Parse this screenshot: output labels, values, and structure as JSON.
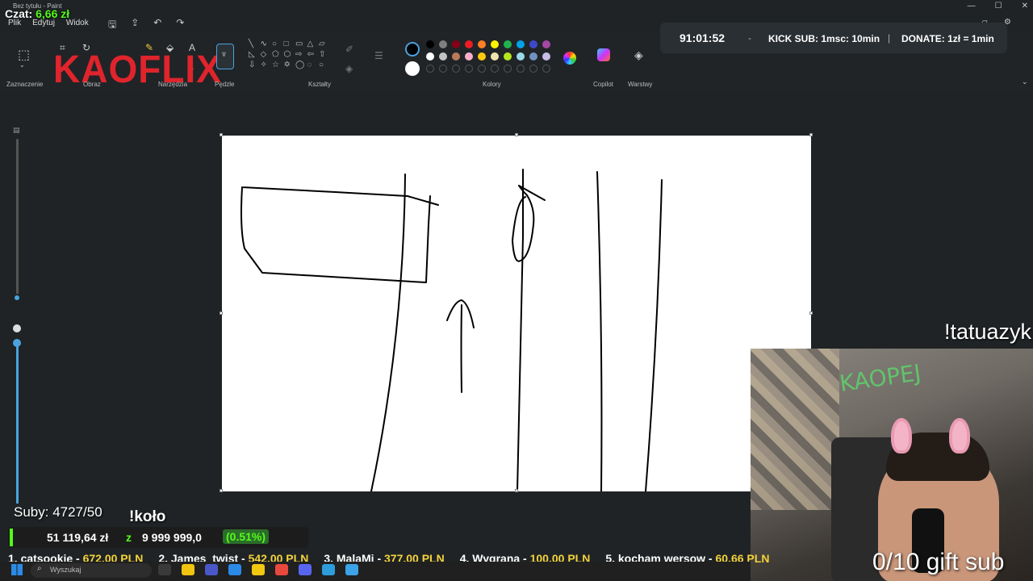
{
  "window": {
    "app_title": "Bez tytułu - Paint",
    "controls": [
      "—",
      "☐",
      "✕"
    ]
  },
  "chat": {
    "label": "Czat:",
    "amount": "6,66 zł"
  },
  "menu": {
    "items": [
      "Plik",
      "Edytuj",
      "Widok"
    ]
  },
  "ribbon": {
    "groups": {
      "selection": "Zaznaczenie",
      "image": "Obraz",
      "tools": "Narzędzia",
      "brushes": "Pędzle",
      "shapes": "Kształty",
      "colors": "Kolory",
      "copilot": "Copilot",
      "layers": "Warstwy"
    },
    "shapes": [
      "╲",
      "∿",
      "○",
      "□",
      "▭",
      "△",
      "▱",
      "◺",
      "◇",
      "⬠",
      "⬡",
      "⇨",
      "⇦",
      "⇧",
      "⇩",
      "✧",
      "☆",
      "✡",
      "◯",
      "◌",
      "○"
    ],
    "primary_color": "#000000",
    "secondary_color": "#ffffff",
    "palette": [
      "#000000",
      "#7f7f7f",
      "#880015",
      "#ed1c24",
      "#ff7f27",
      "#fff200",
      "#22b14c",
      "#00a2e8",
      "#3f48cc",
      "#a349a4",
      "#ffffff",
      "#c3c3c3",
      "#b97a57",
      "#ffaec9",
      "#ffc90e",
      "#efe4b0",
      "#b5e61d",
      "#99d9ea",
      "#7092be",
      "#c8bfe7"
    ]
  },
  "overlay_logo": "KAOFLIX",
  "timer": {
    "time": "91:01:52",
    "kick_sub": "KICK SUB: 1msc: 10min",
    "donate": "DONATE: 1zł = 1min"
  },
  "subs": {
    "label": "Suby: 4727/50"
  },
  "kolo": "!koło",
  "goal": {
    "current": "51 119,64 zł",
    "sep": "z",
    "target": "9 999 999,0",
    "percent": "(0.51%)",
    "progress": 0.0051
  },
  "ranking": [
    {
      "name": "1. catsookie - ",
      "value": "672.00 PLN"
    },
    {
      "name": "2. James_twist - ",
      "value": "542.00 PLN"
    },
    {
      "name": "3. MalaMi - ",
      "value": "377.00 PLN"
    },
    {
      "name": "4. Wygrana - ",
      "value": "100.00 PLN"
    },
    {
      "name": "5. kocham wersow - ",
      "value": "60.66 PLN"
    }
  ],
  "webcam": {
    "sign": "KAOPEJ"
  },
  "tatuazyk": "!tatuazyk",
  "gift_sub": "0/10 gift sub",
  "taskbar": {
    "search_placeholder": "Wyszukaj",
    "apps": [
      "#3a3a3a",
      "#f1c40f",
      "#4a57c9",
      "#2b8ae6",
      "#f2c811",
      "#e9483d",
      "#5865f2",
      "#2d9cdb",
      "#3ba3e6"
    ]
  }
}
